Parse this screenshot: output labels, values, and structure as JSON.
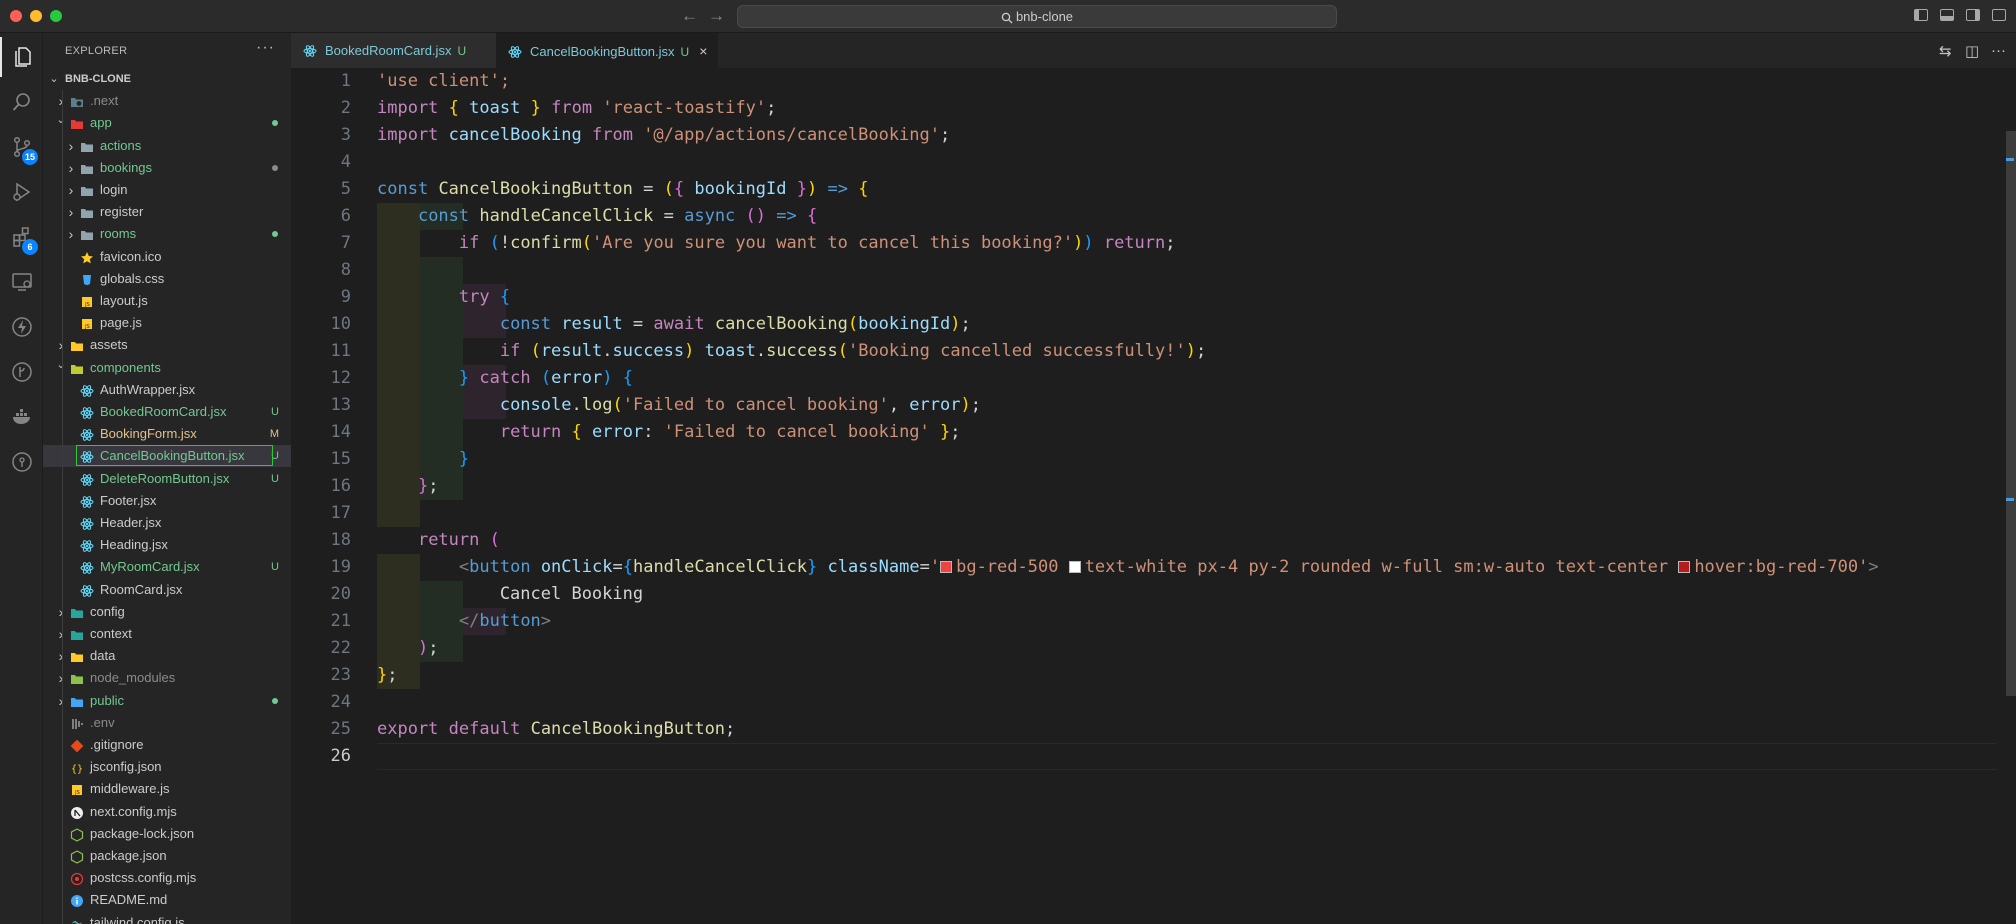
{
  "titlebar": {
    "search_text": "bnb-clone"
  },
  "activity": {
    "scm_badge": "15",
    "extensions_badge": "6"
  },
  "explorer": {
    "title": "EXPLORER",
    "root": "BNB-CLONE",
    "items": [
      {
        "label": ".next",
        "color": "#8b8b8b"
      },
      {
        "label": "app",
        "color": "#73c991"
      },
      {
        "label": "actions",
        "color": "#73c991"
      },
      {
        "label": "bookings",
        "color": "#73c991"
      },
      {
        "label": "login",
        "color": "#cccccc"
      },
      {
        "label": "register",
        "color": "#cccccc"
      },
      {
        "label": "rooms",
        "color": "#73c991"
      },
      {
        "label": "favicon.ico",
        "color": "#cccccc"
      },
      {
        "label": "globals.css",
        "color": "#cccccc"
      },
      {
        "label": "layout.js",
        "color": "#cccccc"
      },
      {
        "label": "page.js",
        "color": "#cccccc"
      },
      {
        "label": "assets",
        "color": "#cccccc"
      },
      {
        "label": "components",
        "color": "#73c991"
      },
      {
        "label": "AuthWrapper.jsx",
        "color": "#cccccc"
      },
      {
        "label": "BookedRoomCard.jsx",
        "color": "#73c991",
        "badge": "U"
      },
      {
        "label": "BookingForm.jsx",
        "color": "#e2c08d",
        "badge": "M"
      },
      {
        "label": "CancelBookingButton.jsx",
        "color": "#73c991",
        "badge": "U"
      },
      {
        "label": "DeleteRoomButton.jsx",
        "color": "#73c991",
        "badge": "U"
      },
      {
        "label": "Footer.jsx",
        "color": "#cccccc"
      },
      {
        "label": "Header.jsx",
        "color": "#cccccc"
      },
      {
        "label": "Heading.jsx",
        "color": "#cccccc"
      },
      {
        "label": "MyRoomCard.jsx",
        "color": "#73c991",
        "badge": "U"
      },
      {
        "label": "RoomCard.jsx",
        "color": "#cccccc"
      },
      {
        "label": "config",
        "color": "#cccccc"
      },
      {
        "label": "context",
        "color": "#cccccc"
      },
      {
        "label": "data",
        "color": "#cccccc"
      },
      {
        "label": "node_modules",
        "color": "#8b8b8b"
      },
      {
        "label": "public",
        "color": "#73c991"
      },
      {
        "label": ".env",
        "color": "#8b8b8b"
      },
      {
        "label": ".gitignore",
        "color": "#cccccc"
      },
      {
        "label": "jsconfig.json",
        "color": "#cccccc"
      },
      {
        "label": "middleware.js",
        "color": "#cccccc"
      },
      {
        "label": "next.config.mjs",
        "color": "#cccccc"
      },
      {
        "label": "package-lock.json",
        "color": "#cccccc"
      },
      {
        "label": "package.json",
        "color": "#cccccc"
      },
      {
        "label": "postcss.config.mjs",
        "color": "#cccccc"
      },
      {
        "label": "README.md",
        "color": "#cccccc"
      },
      {
        "label": "tailwind.config.js",
        "color": "#cccccc"
      }
    ]
  },
  "tabs": [
    {
      "label": "BookedRoomCard.jsx",
      "status": "U"
    },
    {
      "label": "CancelBookingButton.jsx",
      "status": "U",
      "close": "×"
    }
  ],
  "code": {
    "current_line": "26",
    "line_numbers": [
      "1",
      "2",
      "3",
      "4",
      "5",
      "6",
      "7",
      "8",
      "9",
      "10",
      "11",
      "12",
      "13",
      "14",
      "15",
      "16",
      "17",
      "18",
      "19",
      "20",
      "21",
      "22",
      "23",
      "24",
      "25",
      "26"
    ],
    "lines": [
      "'use client';",
      "import { toast } from 'react-toastify';",
      "import cancelBooking from '@/app/actions/cancelBooking';",
      "",
      "const CancelBookingButton = ({ bookingId }) => {",
      "    const handleCancelClick = async () => {",
      "        if (!confirm('Are you sure you want to cancel this booking?')) return;",
      "",
      "        try {",
      "            const result = await cancelBooking(bookingId);",
      "            if (result.success) toast.success('Booking cancelled successfully!');",
      "        } catch (error) {",
      "            console.log('Failed to cancel booking', error);",
      "            return { error: 'Failed to cancel booking' };",
      "        }",
      "    };",
      "",
      "    return (",
      "        <button onClick={handleCancelClick} className='bg-red-500 text-white px-4 py-2 rounded w-full sm:w-auto text-center hover:bg-red-700'>",
      "            Cancel Booking",
      "        </button>",
      "    );",
      "};",
      "",
      "export default CancelBookingButton;",
      ""
    ],
    "swatch_colors": [
      "#ef4444",
      "#ffffff",
      "#b91c1c"
    ]
  }
}
